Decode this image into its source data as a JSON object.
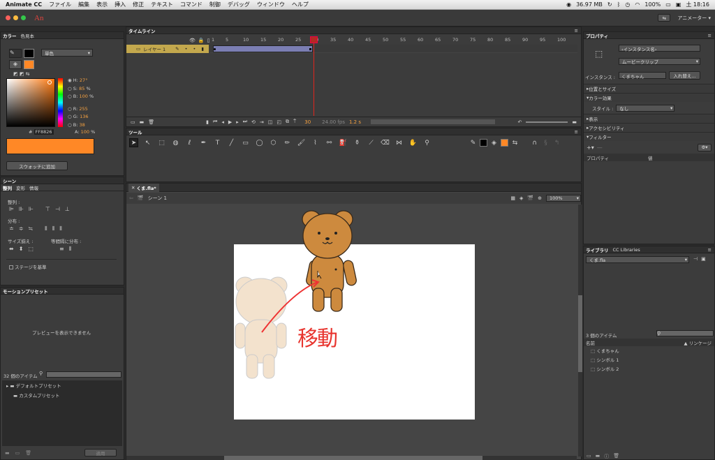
{
  "menubar": {
    "app": "Animate CC",
    "items": [
      "ファイル",
      "編集",
      "表示",
      "挿入",
      "修正",
      "テキスト",
      "コマンド",
      "制御",
      "デバッグ",
      "ウィンドウ",
      "ヘルプ"
    ],
    "memory": "36.97 MB",
    "battery": "100%",
    "time": "土 18:16"
  },
  "appbar": {
    "logo": "An",
    "workspace": "アニメーター"
  },
  "color_panel": {
    "tabs": [
      "カラー",
      "色見本"
    ],
    "fill_type": "単色",
    "hsb": {
      "h_label": "H:",
      "h": "27",
      "h_unit": "°",
      "s_label": "S:",
      "s": "85",
      "s_unit": "%",
      "b_label": "B:",
      "b": "100",
      "b_unit": "%"
    },
    "rgb": {
      "r_label": "R:",
      "r": "255",
      "g_label": "G:",
      "g": "136",
      "b_label": "B:",
      "b": "38"
    },
    "hex_label": "#",
    "hex": "FF8826",
    "alpha_label": "A:",
    "alpha": "100",
    "alpha_unit": "%",
    "swatch_button": "スウォッチに追加",
    "fill_color": "#ff8826"
  },
  "scene_panel": {
    "tabs": [
      "シーン",
      "整列",
      "変形",
      "情報"
    ],
    "align_label": "整列 :",
    "distribute_label": "分布 :",
    "match_size_label": "サイズ揃え :",
    "spacing_label": "等間隔に分布 :",
    "stage_checkbox": "ステージを基準"
  },
  "motion_panel": {
    "title": "モーションプリセット",
    "preview": "プレビューを表示できません",
    "count": "32 個のアイテム",
    "folders": [
      "デフォルトプリセット",
      "カスタムプリセット"
    ],
    "apply": "適用"
  },
  "timeline": {
    "title": "タイムライン",
    "layer": "レイヤー 1",
    "frame_numbers": [
      "1",
      "5",
      "10",
      "15",
      "20",
      "25",
      "30",
      "35",
      "40",
      "45",
      "50",
      "55",
      "60",
      "65",
      "70",
      "75",
      "80",
      "85",
      "90",
      "95",
      "100"
    ],
    "current_frame": "30",
    "fps": "24.00 fps",
    "time": "1.2 s",
    "playhead_frame": 30
  },
  "tools": {
    "title": "ツール",
    "icons": [
      "selection-icon",
      "subselection-icon",
      "free-transform-icon",
      "3d-rotation-icon",
      "lasso-icon",
      "pen-icon",
      "text-icon",
      "line-icon",
      "rectangle-icon",
      "oval-icon",
      "polystar-icon",
      "pencil-icon",
      "paint-brush-icon",
      "brush-icon",
      "bone-icon",
      "paint-bucket-icon",
      "ink-bottle-icon",
      "eyedropper-icon",
      "eraser-icon",
      "width-icon",
      "hand-icon",
      "zoom-icon"
    ]
  },
  "stage": {
    "tab": "くま.fla*",
    "scene": "シーン 1",
    "zoom": "100%",
    "annotation": "移動"
  },
  "properties": {
    "title": "プロパティ",
    "instance_name_placeholder": "‹インスタンス名›",
    "symbol_type": "ムービークリップ",
    "instance_label": "インスタンス :",
    "instance_value": "くまちゃん",
    "swap_button": "入れ替え...",
    "sections": [
      "位置とサイズ",
      "カラー効果",
      "表示",
      "アクセシビリティ",
      "フィルター"
    ],
    "style_label": "スタイル :",
    "style_value": "なし",
    "filter_columns": [
      "プロパティ",
      "値"
    ]
  },
  "library": {
    "tabs": [
      "ライブラリ",
      "CC Libraries"
    ],
    "file": "くま.fla",
    "count": "3 個のアイテム",
    "col_name": "名前",
    "col_link": "リンケージ",
    "items": [
      "くまちゃん",
      "シンボル 1",
      "シンボル 2"
    ]
  }
}
